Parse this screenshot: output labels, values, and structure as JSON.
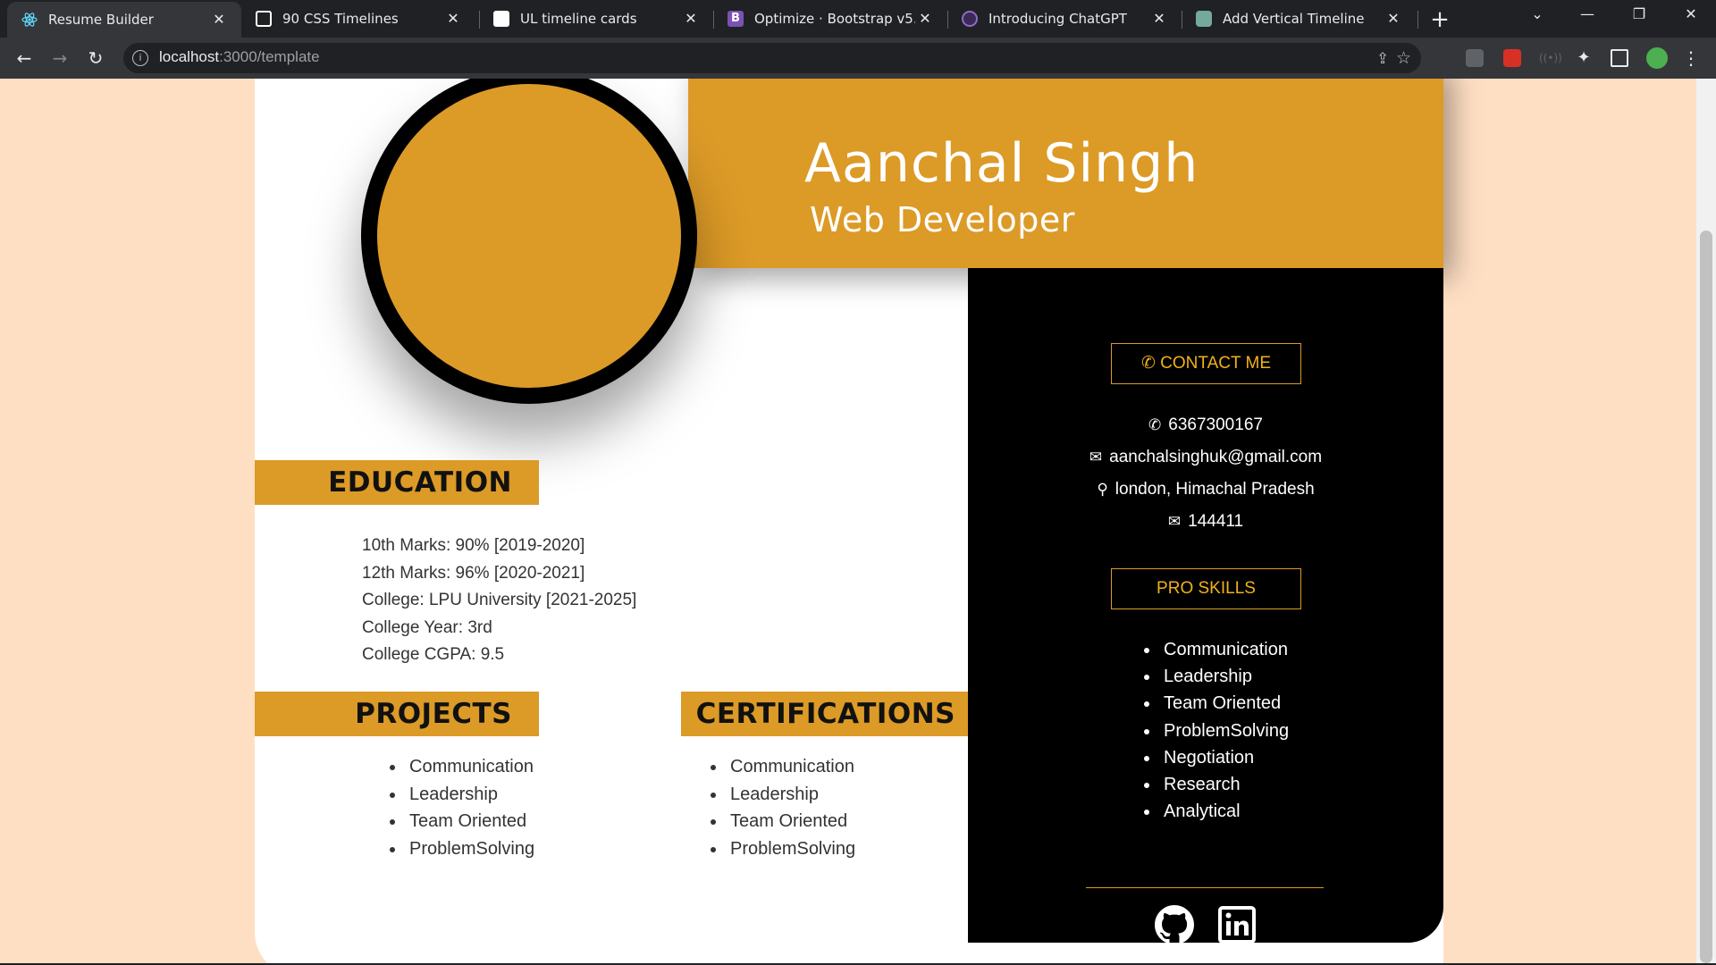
{
  "browser": {
    "tabs": [
      {
        "title": "Resume Builder",
        "icon": "react-icon",
        "color": "#61dafb",
        "active": true
      },
      {
        "title": "90 CSS Timelines",
        "icon": "free-frontend-icon",
        "color": "#ffffff",
        "active": false
      },
      {
        "title": "UL timeline cards",
        "icon": "codepen-icon",
        "color": "#ffffff",
        "active": false
      },
      {
        "title": "Optimize · Bootstrap v5.3",
        "icon": "bootstrap-icon",
        "color": "#7952b3",
        "active": false
      },
      {
        "title": "Introducing ChatGPT",
        "icon": "openai-icon",
        "color": "#6e40c9",
        "active": false
      },
      {
        "title": "Add Vertical Timeline",
        "icon": "chatgpt-icon",
        "color": "#74aa9c",
        "active": false
      }
    ],
    "url_host": "localhost",
    "url_rest": ":3000/template"
  },
  "resume": {
    "name": "Aanchal Singh",
    "role": "Web Developer",
    "accent_color": "#dc9a27",
    "education": {
      "heading": "EDUCATION",
      "items": [
        "10th Marks: 90% [2019-2020]",
        "12th Marks: 96% [2020-2021]",
        "College: LPU University [2021-2025]",
        "College Year: 3rd",
        "College CGPA: 9.5"
      ]
    },
    "projects": {
      "heading": "PROJECTS",
      "items": [
        "Communication",
        "Leadership",
        "Team Oriented",
        "ProblemSolving"
      ]
    },
    "certifications": {
      "heading": "CERTIFICATIONS",
      "items": [
        "Communication",
        "Leadership",
        "Team Oriented",
        "ProblemSolving"
      ]
    },
    "contact": {
      "button": "CONTACT ME",
      "phone": "6367300167",
      "email": "aanchalsinghuk@gmail.com",
      "location": "london, Himachal Pradesh",
      "pin": "144411"
    },
    "skills": {
      "button": "PRO SKILLS",
      "items": [
        "Communication",
        "Leadership",
        "Team Oriented",
        "ProblemSolving",
        "Negotiation",
        "Research",
        "Analytical"
      ]
    }
  }
}
